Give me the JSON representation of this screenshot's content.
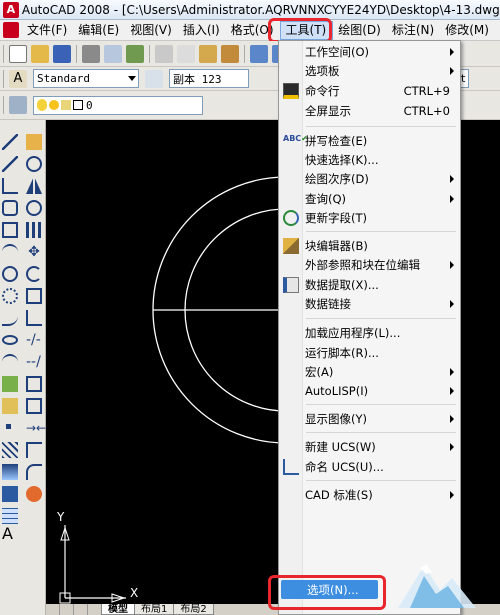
{
  "window": {
    "title": "AutoCAD 2008 - [C:\\Users\\Administrator.AQRVNNXCYYE24YD\\Desktop\\4-13.dwg]"
  },
  "menubar": {
    "items": [
      {
        "label": "文件(F)"
      },
      {
        "label": "编辑(E)"
      },
      {
        "label": "视图(V)"
      },
      {
        "label": "插入(I)"
      },
      {
        "label": "格式(O)"
      },
      {
        "label": "工具(T)"
      },
      {
        "label": "绘图(D)"
      },
      {
        "label": "标注(N)"
      },
      {
        "label": "修改(M)"
      }
    ],
    "active_index": 5
  },
  "styles_toolbar": {
    "text_style": "Standard",
    "dim_style": "副本 123",
    "right_style": "St"
  },
  "layer_toolbar": {
    "layer_value": "0"
  },
  "tools_menu": {
    "items": [
      {
        "label": "工作空间(O)",
        "submenu": true
      },
      {
        "label": "选项板",
        "submenu": true
      },
      {
        "label": "命令行",
        "shortcut": "CTRL+9",
        "icon": "command-line-icon"
      },
      {
        "label": "全屏显示",
        "shortcut": "CTRL+0"
      },
      {
        "label": "拼写检查(E)",
        "icon": "spell-check-icon"
      },
      {
        "label": "快速选择(K)..."
      },
      {
        "label": "绘图次序(D)",
        "submenu": true
      },
      {
        "label": "查询(Q)",
        "submenu": true
      },
      {
        "label": "更新字段(T)",
        "icon": "update-field-icon"
      },
      {
        "label": "块编辑器(B)",
        "icon": "block-editor-icon"
      },
      {
        "label": "外部参照和块在位编辑",
        "submenu": true
      },
      {
        "label": "数据提取(X)...",
        "icon": "data-extraction-icon"
      },
      {
        "label": "数据链接",
        "submenu": true
      },
      {
        "label": "加载应用程序(L)..."
      },
      {
        "label": "运行脚本(R)..."
      },
      {
        "label": "宏(A)",
        "submenu": true
      },
      {
        "label": "AutoLISP(I)",
        "submenu": true
      },
      {
        "label": "显示图像(Y)",
        "submenu": true
      },
      {
        "label": "新建 UCS(W)",
        "submenu": true
      },
      {
        "label": "命名 UCS(U)...",
        "icon": "named-ucs-icon"
      },
      {
        "label": "CAD 标准(S)",
        "submenu": true
      },
      {
        "label": "选项(N)..."
      }
    ]
  },
  "layout_tabs": {
    "items": [
      "模型",
      "布局1",
      "布局2"
    ]
  },
  "ucs": {
    "x_label": "X",
    "y_label": "Y"
  },
  "colors": {
    "highlight": "#3d8ee0",
    "annotation_red": "#e8262c",
    "canvas": "#000000"
  }
}
